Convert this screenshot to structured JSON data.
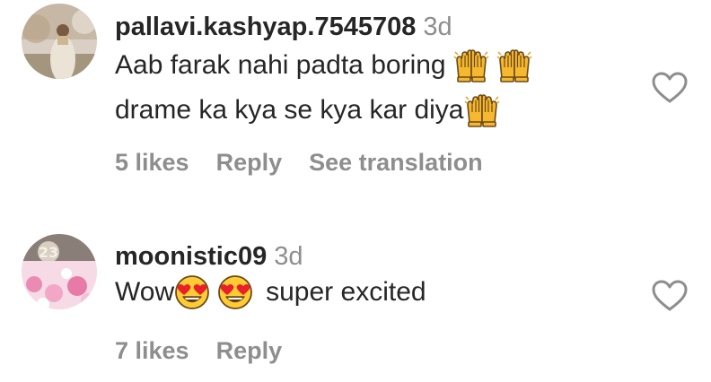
{
  "comments": [
    {
      "username": "pallavi.kashyap.7545708",
      "timestamp": "3d",
      "text_line1": "Aab farak nahi padta boring",
      "text_line2": "drame ka kya se kya kar diya",
      "emojis_line1": [
        "raising-hands-emoji",
        "raising-hands-emoji"
      ],
      "emojis_line2": [
        "raising-hands-emoji"
      ],
      "likes": "5 likes",
      "reply": "Reply",
      "translation": "See translation",
      "avatar": "profile-photo"
    },
    {
      "username": "moonistic09",
      "timestamp": "3d",
      "text_before": "Wow",
      "text_after": "super excited",
      "emojis": [
        "heart-eyes-emoji",
        "heart-eyes-emoji"
      ],
      "likes": "7 likes",
      "reply": "Reply",
      "avatar": "profile-photo"
    }
  ],
  "icons": {
    "like": "heart-outline-icon"
  },
  "colors": {
    "text": "#262626",
    "secondary": "#8e8e8e",
    "background": "#ffffff"
  }
}
